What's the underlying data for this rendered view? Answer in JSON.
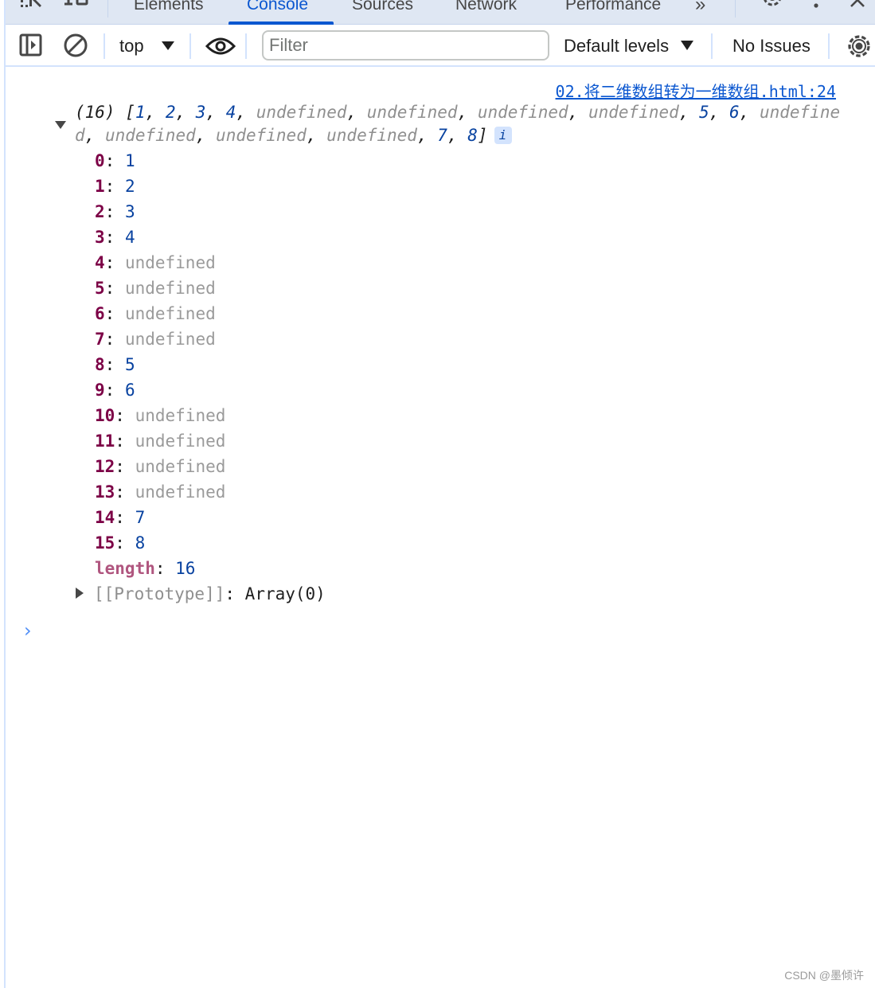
{
  "tabbar": {
    "tabs": [
      {
        "label": "Elements",
        "active": false
      },
      {
        "label": "Console",
        "active": true
      },
      {
        "label": "Sources",
        "active": false
      },
      {
        "label": "Network",
        "active": false
      },
      {
        "label": "Performance",
        "active": false
      }
    ],
    "more_tabs_glyph": "»",
    "icons": [
      "inspect-element-icon",
      "device-toolbar-icon",
      "settings-icon",
      "more-options-icon",
      "close-icon"
    ]
  },
  "toolbar": {
    "context": "top",
    "filter_placeholder": "Filter",
    "filter_value": "",
    "levels": "Default levels",
    "issues": "No Issues"
  },
  "console": {
    "source_link": "02.将二维数组转为一维数组.html:24",
    "array_count": "(16)",
    "array_preview": [
      "1",
      "2",
      "3",
      "4",
      "undefined",
      "undefined",
      "undefined",
      "undefined",
      "5",
      "6",
      "undefined",
      "undefined",
      "undefined",
      "undefined",
      "7",
      "8"
    ],
    "info_badge": "i",
    "entries": [
      {
        "key": "0",
        "value": "1",
        "type": "number"
      },
      {
        "key": "1",
        "value": "2",
        "type": "number"
      },
      {
        "key": "2",
        "value": "3",
        "type": "number"
      },
      {
        "key": "3",
        "value": "4",
        "type": "number"
      },
      {
        "key": "4",
        "value": "undefined",
        "type": "undefined"
      },
      {
        "key": "5",
        "value": "undefined",
        "type": "undefined"
      },
      {
        "key": "6",
        "value": "undefined",
        "type": "undefined"
      },
      {
        "key": "7",
        "value": "undefined",
        "type": "undefined"
      },
      {
        "key": "8",
        "value": "5",
        "type": "number"
      },
      {
        "key": "9",
        "value": "6",
        "type": "number"
      },
      {
        "key": "10",
        "value": "undefined",
        "type": "undefined"
      },
      {
        "key": "11",
        "value": "undefined",
        "type": "undefined"
      },
      {
        "key": "12",
        "value": "undefined",
        "type": "undefined"
      },
      {
        "key": "13",
        "value": "undefined",
        "type": "undefined"
      },
      {
        "key": "14",
        "value": "7",
        "type": "number"
      },
      {
        "key": "15",
        "value": "8",
        "type": "number"
      }
    ],
    "length_key": "length",
    "length_value": "16",
    "prototype_key": "[[Prototype]]",
    "prototype_value": "Array(0)",
    "prompt_glyph": "›"
  },
  "watermark": "CSDN @墨倾许"
}
